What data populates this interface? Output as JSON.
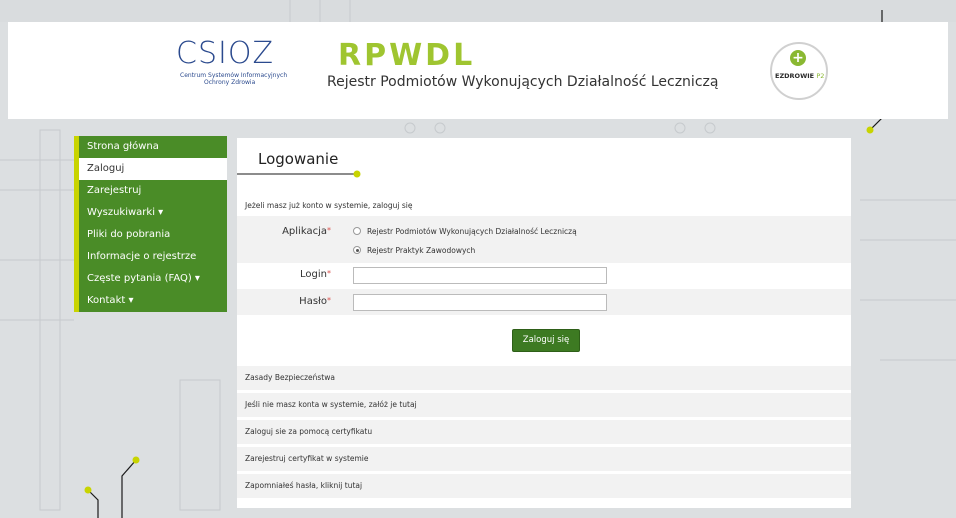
{
  "header": {
    "csioz_logo": "CSIOZ",
    "csioz_line1": "Centrum Systemów Informacyjnych",
    "csioz_line2": "Ochrony Zdrowia",
    "title": "RPWDL",
    "subtitle": "Rejestr Podmiotów Wykonujących Działalność Leczniczą",
    "ezdrowie_main": "EZDROWIE",
    "ezdrowie_suffix": "P2"
  },
  "sidebar": {
    "items": [
      {
        "label": "Strona główna",
        "active": false
      },
      {
        "label": "Zaloguj",
        "active": true
      },
      {
        "label": "Zarejestruj",
        "active": false
      },
      {
        "label": "Wyszukiwarki ▾",
        "active": false
      },
      {
        "label": "Pliki do pobrania",
        "active": false
      },
      {
        "label": "Informacje o rejestrze",
        "active": false
      },
      {
        "label": "Częste pytania (FAQ) ▾",
        "active": false
      },
      {
        "label": "Kontakt ▾",
        "active": false
      }
    ]
  },
  "login": {
    "title": "Logowanie",
    "intro": "Jeżeli masz już konto w systemie, zaloguj się",
    "application_label": "Aplikacja",
    "required_mark": "*",
    "radio_options": [
      {
        "label": "Rejestr Podmiotów Wykonujących Działalność Leczniczą",
        "checked": false
      },
      {
        "label": "Rejestr Praktyk Zawodowych",
        "checked": true
      }
    ],
    "login_label": "Login",
    "password_label": "Hasło",
    "login_value": "",
    "password_value": "",
    "submit_label": "Zaloguj się"
  },
  "links": [
    "Zasady Bezpieczeństwa",
    "Jeśli nie masz konta w systemie, załóż je tutaj",
    "Zaloguj sie za pomocą certyfikatu",
    "Zarejestruj certyfikat w systemie",
    "Zapomniałeś hasła, kliknij tutaj"
  ],
  "colors": {
    "accent_green": "#4a8c27",
    "accent_lime": "#c8d400",
    "title_green": "#9fc530"
  }
}
